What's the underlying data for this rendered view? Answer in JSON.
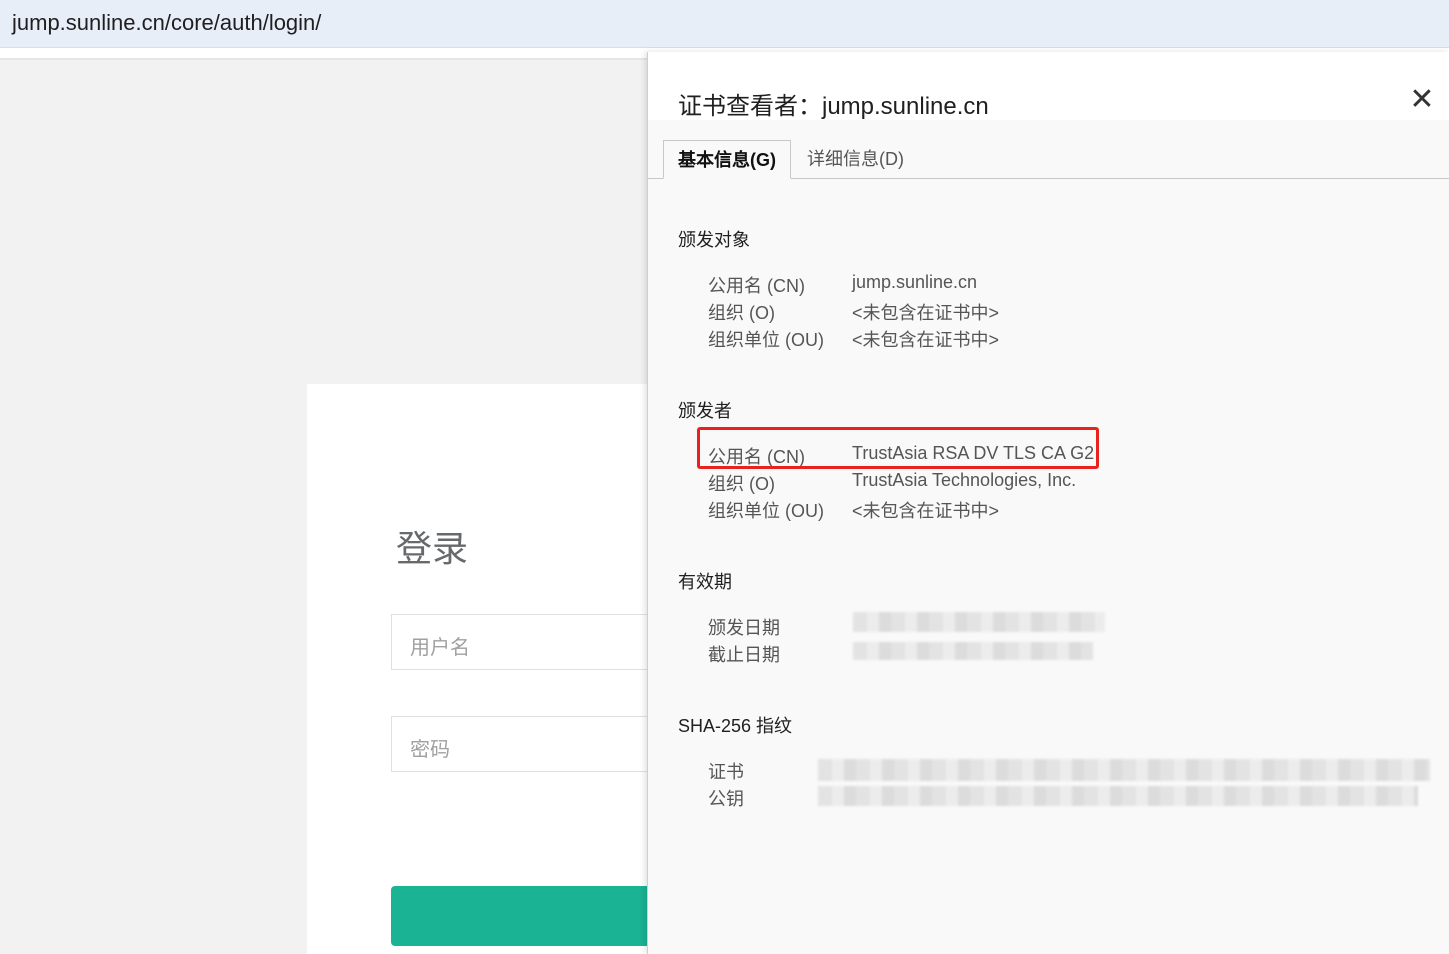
{
  "browser": {
    "url": "jump.sunline.cn/core/auth/login/"
  },
  "login": {
    "title": "登录",
    "username_placeholder": "用户名",
    "password_placeholder": "密码",
    "accent_color": "#1ab394"
  },
  "dialog": {
    "title": "证书查看者：jump.sunline.cn",
    "close_icon": "close-icon",
    "tabs": [
      {
        "label": "基本信息(G)",
        "active": true
      },
      {
        "label": "详细信息(D)",
        "active": false
      }
    ],
    "issued_to": {
      "heading": "颁发对象",
      "rows": [
        {
          "label": "公用名 (CN)",
          "value": "jump.sunline.cn"
        },
        {
          "label": "组织 (O)",
          "value": "<未包含在证书中>"
        },
        {
          "label": "组织单位 (OU)",
          "value": "<未包含在证书中>"
        }
      ]
    },
    "issued_by": {
      "heading": "颁发者",
      "rows": [
        {
          "label": "公用名 (CN)",
          "value": "TrustAsia RSA DV TLS CA G2"
        },
        {
          "label": "组织 (O)",
          "value": "TrustAsia Technologies, Inc."
        },
        {
          "label": "组织单位 (OU)",
          "value": "<未包含在证书中>"
        }
      ]
    },
    "validity": {
      "heading": "有效期",
      "rows": [
        {
          "label": "颁发日期"
        },
        {
          "label": "截止日期"
        }
      ]
    },
    "fingerprints": {
      "heading": "SHA-256 指纹",
      "rows": [
        {
          "label": "证书"
        },
        {
          "label": "公钥"
        }
      ]
    },
    "highlight_color": "#e8231f"
  }
}
